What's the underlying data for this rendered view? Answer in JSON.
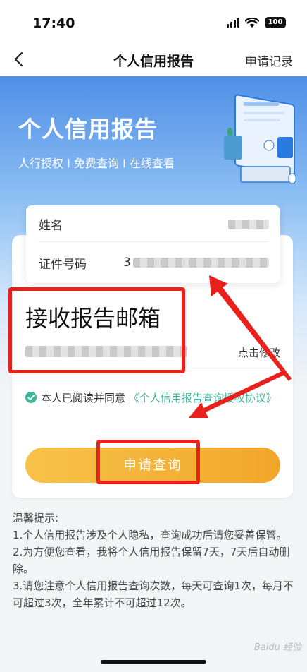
{
  "status_bar": {
    "time": "17:40",
    "battery": "100"
  },
  "nav": {
    "title": "个人信用报告",
    "record": "申请记录"
  },
  "hero": {
    "title": "个人信用报告",
    "subtitle": "人行授权 I 免费查询 I 在线查看"
  },
  "form": {
    "name_label": "姓名",
    "id_label": "证件号码",
    "id_prefix": "3",
    "email_label": "接收报告邮箱",
    "modify": "点击修改"
  },
  "agreement": {
    "prefix": "本人已阅读并同意",
    "link": "《个人信用报告查询授权协议》"
  },
  "apply_button": "申请查询",
  "tips": {
    "title": "温馨提示:",
    "items": [
      "1.个人信用报告涉及个人隐私，查询成功后请您妥善保管。",
      "2.为方便您查看，我将个人信用报告保留7天，7天后自动删除。",
      "3.请您注意个人信用报告查询次数，每天可查询1次，每月不可超过3次，全年累计不可超过12次。"
    ]
  },
  "watermark": "Baidu 经验",
  "colors": {
    "accent": "#f1a62a",
    "link": "#3fb59a",
    "annotation": "#e8211d",
    "hero": "#4f8fe6"
  },
  "icons": [
    "back-chevron-icon",
    "signal-icon",
    "wifi-icon",
    "battery-icon",
    "check-circle-icon"
  ]
}
